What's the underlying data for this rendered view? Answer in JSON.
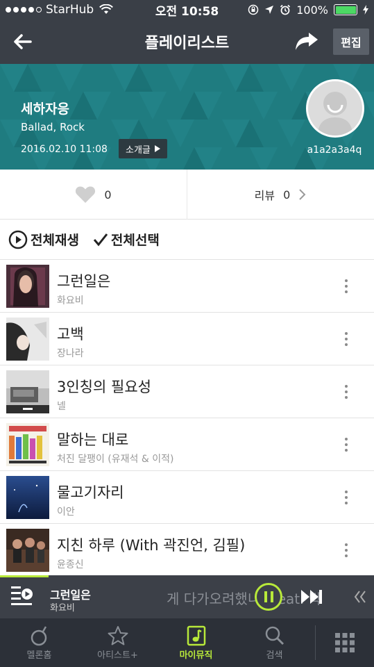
{
  "status_bar": {
    "carrier": "StarHub",
    "time": "오전 10:58",
    "battery": "100%"
  },
  "header": {
    "title": "플레이리스트",
    "edit_label": "편집"
  },
  "playlist": {
    "name": "세하자응",
    "genre": "Ballad, Rock",
    "date": "2016.02.10 11:08",
    "intro_label": "소개글",
    "username": "a1a2a3a4q"
  },
  "stats": {
    "like_count": "0",
    "review_label": "리뷰",
    "review_count": "0"
  },
  "actions": {
    "play_all": "전체재생",
    "select_all": "전체선택"
  },
  "tracks": [
    {
      "title": "그런일은",
      "artist": "화요비"
    },
    {
      "title": "고백",
      "artist": "장나라"
    },
    {
      "title": "3인칭의 필요성",
      "artist": "넬"
    },
    {
      "title": "말하는 대로",
      "artist": "처진 달팽이 (유재석 & 이적)"
    },
    {
      "title": "물고기자리",
      "artist": "이안"
    },
    {
      "title": "지친 하루 (With 곽진언, 김필)",
      "artist": "윤종신"
    }
  ],
  "player": {
    "title": "그런일은",
    "artist": "화요비",
    "ghost_text": "게 다가오려했니 (Feat. 박"
  },
  "tabs": [
    {
      "label": "멜론홈",
      "icon": "melon-home-icon"
    },
    {
      "label": "아티스트+",
      "icon": "star-icon"
    },
    {
      "label": "마이뮤직",
      "icon": "my-music-icon"
    },
    {
      "label": "검색",
      "icon": "search-icon"
    }
  ],
  "colors": {
    "header_bg": "#3a3f47",
    "hero_bg": "#1f7c80",
    "accent": "#b8e93a",
    "battery": "#4cd964"
  }
}
